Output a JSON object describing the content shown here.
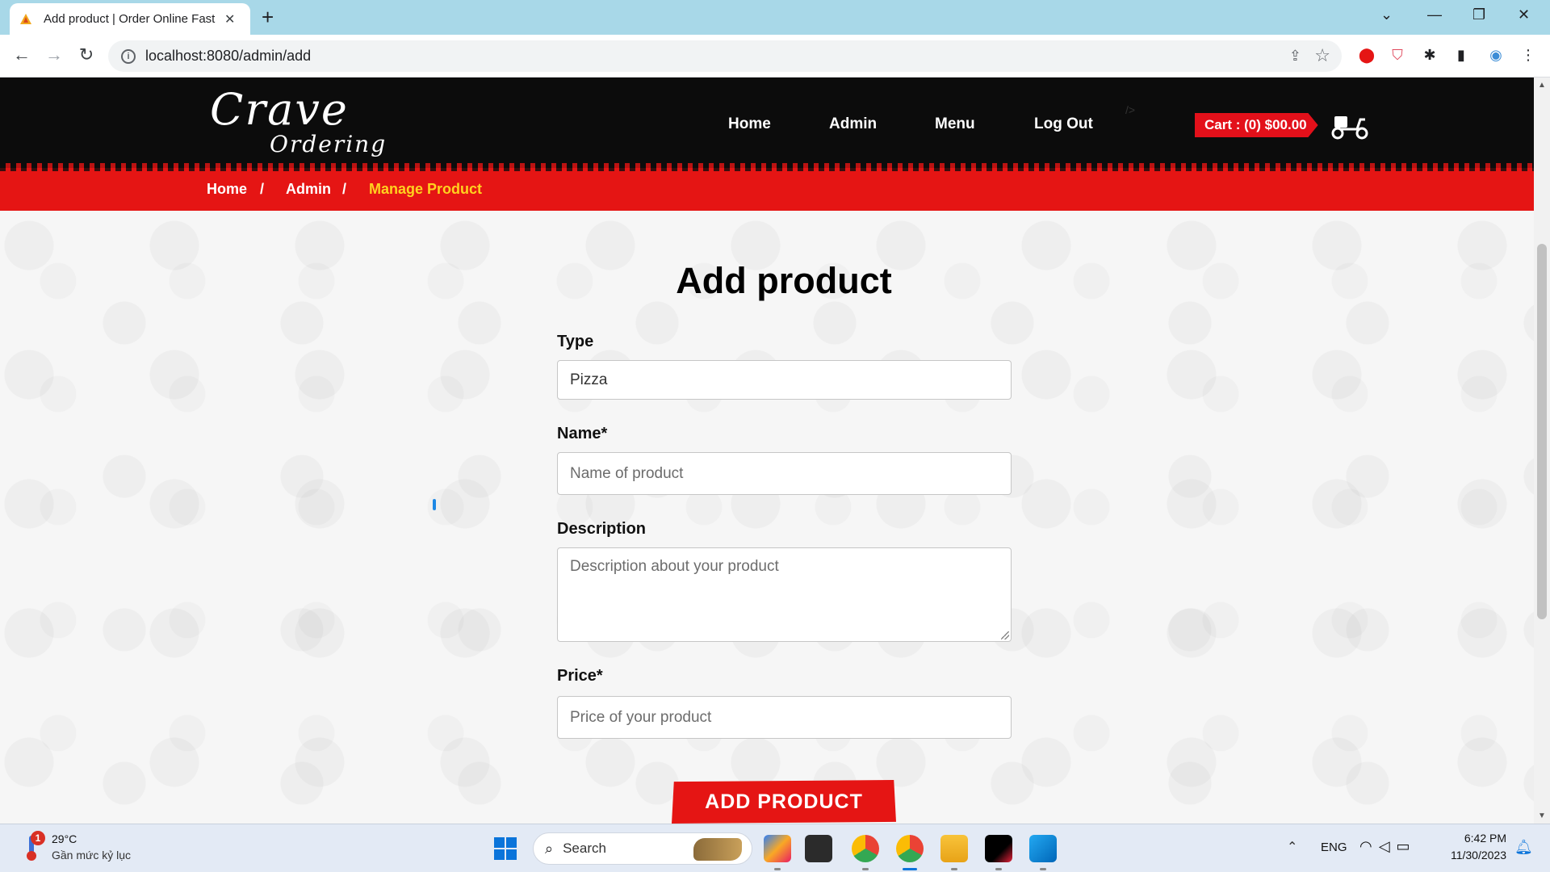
{
  "browser": {
    "tab_title": "Add product | Order Online Fast",
    "url": "localhost:8080/admin/add",
    "new_tab": "+",
    "close_tab": "✕"
  },
  "site": {
    "logo_line1": "Crave",
    "logo_line2": "Ordering",
    "nav": [
      "Home",
      "Admin",
      "Menu",
      "Log Out"
    ],
    "stray_text": "/>",
    "cart_label": "Cart : (0) $00.00"
  },
  "breadcrumb": {
    "items": [
      "Home",
      "Admin",
      "Manage Product"
    ],
    "separator": "/"
  },
  "form": {
    "title": "Add product",
    "type_label": "Type",
    "type_value": "Pizza",
    "name_label": "Name*",
    "name_placeholder": "Name of product",
    "description_label": "Description",
    "description_placeholder": "Description about your product",
    "price_label": "Price*",
    "price_placeholder": "Price of your product",
    "submit_label": "ADD PRODUCT"
  },
  "taskbar": {
    "weather_badge": "1",
    "weather_temp": "29°C",
    "weather_desc": "Gần mức kỷ lục",
    "search_label": "Search",
    "lang": "ENG",
    "time": "6:42 PM",
    "date": "11/30/2023"
  },
  "colors": {
    "brand_red": "#e51514",
    "breadcrumb_active": "#ffd21f",
    "header_bg": "#0c0c0c"
  }
}
